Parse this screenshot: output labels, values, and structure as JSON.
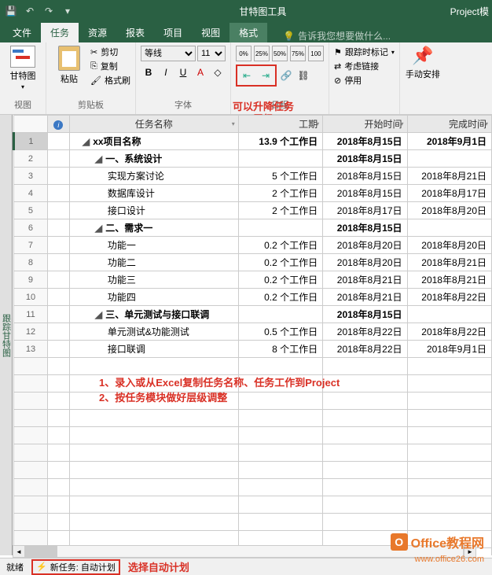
{
  "titlebar": {
    "tool_context": "甘特图工具",
    "filename": "Project模"
  },
  "tabs": {
    "file": "文件",
    "task": "任务",
    "resource": "资源",
    "report": "报表",
    "project": "项目",
    "view": "视图",
    "format": "格式",
    "tellme": "告诉我您想要做什么..."
  },
  "ribbon": {
    "gantt_btn": "甘特图",
    "view_label": "视图",
    "paste_btn": "粘贴",
    "cut": "剪切",
    "copy": "复制",
    "format_painter": "格式刷",
    "clipboard_label": "剪贴板",
    "font_name": "等线",
    "font_size": "11",
    "font_label": "字体",
    "schedule_label": "日程",
    "track": "跟踪时标记",
    "respect_links": "考虑链接",
    "deactivate": "停用",
    "manual": "手动安排"
  },
  "annotations": {
    "indent": "可以升降任务层级",
    "note1": "1、录入或从Excel复制任务名称、任务工作到Project",
    "note2": "2、按任务模块做好层级调整",
    "auto_note": "选择自动计划"
  },
  "columns": {
    "info": "",
    "name": "任务名称",
    "duration": "工期",
    "start": "开始时间",
    "finish": "完成时间"
  },
  "rows": [
    {
      "n": "1",
      "lvl": 1,
      "sum": true,
      "name": "xx项目名称",
      "dur": "13.9 个工作日",
      "start": "2018年8月15日",
      "finish": "2018年9月1日"
    },
    {
      "n": "2",
      "lvl": 2,
      "sum": true,
      "name": "一、系统设计",
      "dur": "",
      "start": "2018年8月15日",
      "finish": ""
    },
    {
      "n": "3",
      "lvl": 3,
      "sum": false,
      "name": "实现方案讨论",
      "dur": "5 个工作日",
      "start": "2018年8月15日",
      "finish": "2018年8月21日"
    },
    {
      "n": "4",
      "lvl": 3,
      "sum": false,
      "name": "数据库设计",
      "dur": "2 个工作日",
      "start": "2018年8月15日",
      "finish": "2018年8月17日"
    },
    {
      "n": "5",
      "lvl": 3,
      "sum": false,
      "name": "接口设计",
      "dur": "2 个工作日",
      "start": "2018年8月17日",
      "finish": "2018年8月20日"
    },
    {
      "n": "6",
      "lvl": 2,
      "sum": true,
      "name": "二、需求一",
      "dur": "",
      "start": "2018年8月15日",
      "finish": ""
    },
    {
      "n": "7",
      "lvl": 3,
      "sum": false,
      "name": "功能一",
      "dur": "0.2 个工作日",
      "start": "2018年8月20日",
      "finish": "2018年8月20日"
    },
    {
      "n": "8",
      "lvl": 3,
      "sum": false,
      "name": "功能二",
      "dur": "0.2 个工作日",
      "start": "2018年8月20日",
      "finish": "2018年8月21日"
    },
    {
      "n": "9",
      "lvl": 3,
      "sum": false,
      "name": "功能三",
      "dur": "0.2 个工作日",
      "start": "2018年8月21日",
      "finish": "2018年8月21日"
    },
    {
      "n": "10",
      "lvl": 3,
      "sum": false,
      "name": "功能四",
      "dur": "0.2 个工作日",
      "start": "2018年8月21日",
      "finish": "2018年8月22日"
    },
    {
      "n": "11",
      "lvl": 2,
      "sum": true,
      "name": "三、单元测试与接口联调",
      "dur": "",
      "start": "2018年8月15日",
      "finish": ""
    },
    {
      "n": "12",
      "lvl": 3,
      "sum": false,
      "name": "单元测试&功能测试",
      "dur": "0.5 个工作日",
      "start": "2018年8月22日",
      "finish": "2018年8月22日"
    },
    {
      "n": "13",
      "lvl": 3,
      "sum": false,
      "name": "接口联调",
      "dur": "8 个工作日",
      "start": "2018年8月22日",
      "finish": "2018年9月1日"
    }
  ],
  "status": {
    "ready": "就绪",
    "new_task": "新任务: 自动计划"
  },
  "sidelabel": "跟踪甘特图",
  "watermark": {
    "brand": "Office教程网",
    "url": "www.office26.com"
  }
}
